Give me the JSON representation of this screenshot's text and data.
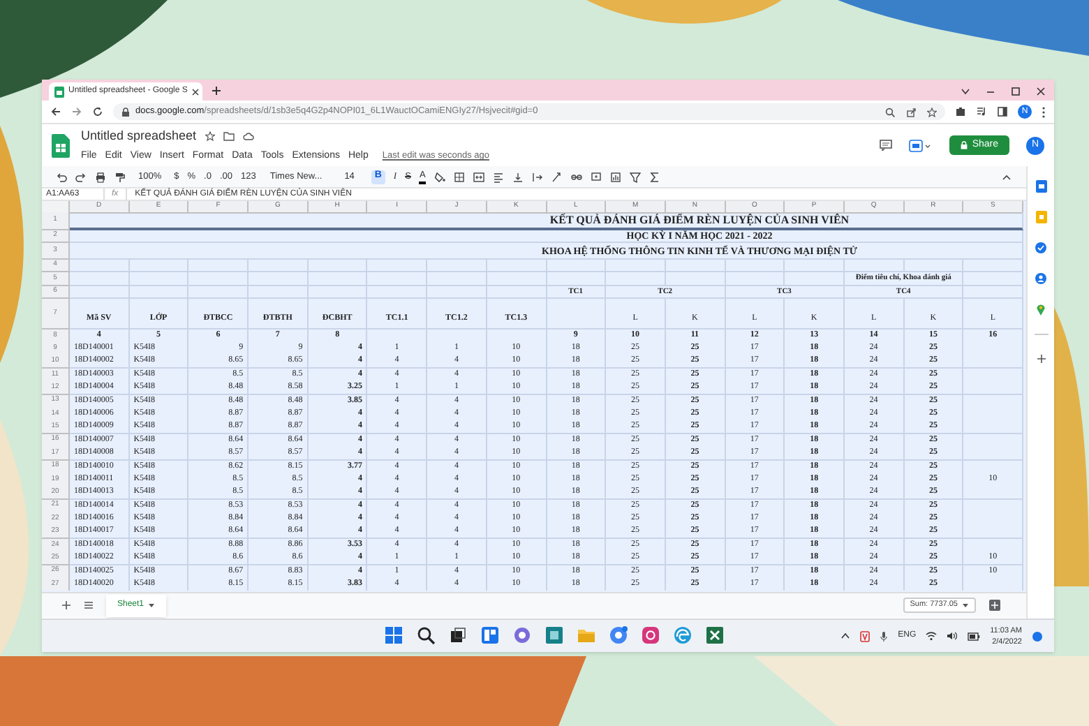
{
  "browser": {
    "tab_title": "Untitled spreadsheet - Google S",
    "url_domain": "docs.google.com",
    "url_path": "/spreadsheets/d/1sb3e5q4G2p4NOPI01_6L1WauctOCamiENGIy27/Hsjvecit#gid=0",
    "avatar": "N"
  },
  "doc": {
    "title": "Untitled spreadsheet",
    "menu": [
      "File",
      "Edit",
      "View",
      "Insert",
      "Format",
      "Data",
      "Tools",
      "Extensions",
      "Help"
    ],
    "last_edit": "Last edit was seconds ago",
    "share": "Share",
    "avatar": "N"
  },
  "toolbar": {
    "zoom": "100%",
    "currency": "$",
    "percent": "%",
    "decimal_less": ".0",
    "decimal_more": ".00",
    "number_format": "123",
    "font": "Times New...",
    "font_size": "14",
    "bold": {
      "label": "B",
      "on": true
    },
    "italic": "I",
    "strike": "S",
    "text_color": "A"
  },
  "formula_bar": {
    "cell_ref": "A1:AA63",
    "fx": "fx",
    "content": "KẾT QUẢ ĐÁNH GIÁ ĐIỂM RÈN LUYỆN CỦA SINH VIÊN"
  },
  "sheet": {
    "columns": [
      "D",
      "E",
      "F",
      "G",
      "H",
      "I",
      "J",
      "K",
      "L",
      "M",
      "N",
      "O",
      "P",
      "Q",
      "R",
      "S"
    ],
    "rows": [
      {
        "row": "1",
        "kind": "title",
        "text": "KẾT QUẢ ĐÁNH GIÁ ĐIỂM RÈN LUYỆN CỦA SINH VIÊN"
      },
      {
        "row": "2",
        "kind": "title",
        "text": "HỌC KỲ I NĂM HỌC 2021 - 2022"
      },
      {
        "row": "3",
        "kind": "title",
        "text": "KHOA HỆ THỐNG THÔNG TIN KINH TẾ VÀ THƯƠNG MẠI ĐIỆN TỬ"
      },
      {
        "row": "4",
        "kind": "blank"
      },
      {
        "row": "5",
        "kind": "note",
        "text": "Điểm tiêu chí, Khoa đánh giá"
      },
      {
        "row": "6",
        "kind": "groups",
        "groups": [
          "TC1",
          "TC2",
          "TC3",
          "TC4"
        ]
      },
      {
        "row": "7",
        "kind": "labels",
        "cells": [
          "Mã SV",
          "LỚP",
          "ĐTBCC",
          "ĐTBTH",
          "ĐCBHT",
          "TC1.1",
          "TC1.2",
          "TC1.3"
        ],
        "sub": [
          "L",
          "K",
          "L",
          "K",
          "L",
          "K",
          "L"
        ]
      },
      {
        "row": "8",
        "kind": "index",
        "cells": [
          "4",
          "5",
          "6",
          "7",
          "8"
        ],
        "sub": [
          "9",
          "10",
          "11",
          "12",
          "13",
          "14",
          "15",
          "16"
        ]
      },
      {
        "row": "9",
        "kind": "data",
        "cells": [
          "18D140001",
          "K54I8",
          "9",
          "9",
          "4",
          "1",
          "1",
          "10",
          "18",
          "25",
          "25",
          "17",
          "18",
          "24",
          "25"
        ]
      },
      {
        "row": "10",
        "kind": "data",
        "cells": [
          "18D140002",
          "K54I8",
          "8.65",
          "8.65",
          "4",
          "4",
          "4",
          "10",
          "18",
          "25",
          "25",
          "17",
          "18",
          "24",
          "25"
        ]
      },
      {
        "row": "11",
        "kind": "data",
        "cells": [
          "18D140003",
          "K54I8",
          "8.5",
          "8.5",
          "4",
          "4",
          "4",
          "10",
          "18",
          "25",
          "25",
          "17",
          "18",
          "24",
          "25"
        ]
      },
      {
        "row": "12",
        "kind": "data",
        "cells": [
          "18D140004",
          "K54I8",
          "8.48",
          "8.58",
          "3.25",
          "1",
          "1",
          "10",
          "18",
          "25",
          "25",
          "17",
          "18",
          "24",
          "25"
        ]
      },
      {
        "row": "13",
        "kind": "data",
        "cells": [
          "18D140005",
          "K54I8",
          "8.48",
          "8.48",
          "3.85",
          "4",
          "4",
          "10",
          "18",
          "25",
          "25",
          "17",
          "18",
          "24",
          "25"
        ]
      },
      {
        "row": "14",
        "kind": "data",
        "cells": [
          "18D140006",
          "K54I8",
          "8.87",
          "8.87",
          "4",
          "4",
          "4",
          "10",
          "18",
          "25",
          "25",
          "17",
          "18",
          "24",
          "25"
        ]
      },
      {
        "row": "15",
        "kind": "data",
        "cells": [
          "18D140009",
          "K54I8",
          "8.87",
          "8.87",
          "4",
          "4",
          "4",
          "10",
          "18",
          "25",
          "25",
          "17",
          "18",
          "24",
          "25"
        ]
      },
      {
        "row": "16",
        "kind": "data",
        "cells": [
          "18D140007",
          "K54I8",
          "8.64",
          "8.64",
          "4",
          "4",
          "4",
          "10",
          "18",
          "25",
          "25",
          "17",
          "18",
          "24",
          "25"
        ]
      },
      {
        "row": "17",
        "kind": "data",
        "cells": [
          "18D140008",
          "K54I8",
          "8.57",
          "8.57",
          "4",
          "4",
          "4",
          "10",
          "18",
          "25",
          "25",
          "17",
          "18",
          "24",
          "25"
        ]
      },
      {
        "row": "18",
        "kind": "data",
        "cells": [
          "18D140010",
          "K54I8",
          "8.62",
          "8.15",
          "3.77",
          "4",
          "4",
          "10",
          "18",
          "25",
          "25",
          "17",
          "18",
          "24",
          "25"
        ]
      },
      {
        "row": "19",
        "kind": "data",
        "cells": [
          "18D140011",
          "K54I8",
          "8.5",
          "8.5",
          "4",
          "4",
          "4",
          "10",
          "18",
          "25",
          "25",
          "17",
          "18",
          "24",
          "25"
        ],
        "extra": "10"
      },
      {
        "row": "20",
        "kind": "data",
        "cells": [
          "18D140013",
          "K54I8",
          "8.5",
          "8.5",
          "4",
          "4",
          "4",
          "10",
          "18",
          "25",
          "25",
          "17",
          "18",
          "24",
          "25"
        ]
      },
      {
        "row": "21",
        "kind": "data",
        "cells": [
          "18D140014",
          "K54I8",
          "8.53",
          "8.53",
          "4",
          "4",
          "4",
          "10",
          "18",
          "25",
          "25",
          "17",
          "18",
          "24",
          "25"
        ]
      },
      {
        "row": "22",
        "kind": "data",
        "cells": [
          "18D140016",
          "K54I8",
          "8.84",
          "8.84",
          "4",
          "4",
          "4",
          "10",
          "18",
          "25",
          "25",
          "17",
          "18",
          "24",
          "25"
        ]
      },
      {
        "row": "23",
        "kind": "data",
        "cells": [
          "18D140017",
          "K54I8",
          "8.64",
          "8.64",
          "4",
          "4",
          "4",
          "10",
          "18",
          "25",
          "25",
          "17",
          "18",
          "24",
          "25"
        ]
      },
      {
        "row": "24",
        "kind": "data",
        "cells": [
          "18D140018",
          "K54I8",
          "8.88",
          "8.86",
          "3.53",
          "4",
          "4",
          "10",
          "18",
          "25",
          "25",
          "17",
          "18",
          "24",
          "25"
        ]
      },
      {
        "row": "25",
        "kind": "data",
        "cells": [
          "18D140022",
          "K54I8",
          "8.6",
          "8.6",
          "4",
          "1",
          "1",
          "10",
          "18",
          "25",
          "25",
          "17",
          "18",
          "24",
          "25"
        ],
        "extra": "10"
      },
      {
        "row": "26",
        "kind": "data",
        "cells": [
          "18D140025",
          "K54I8",
          "8.67",
          "8.83",
          "4",
          "1",
          "4",
          "10",
          "18",
          "25",
          "25",
          "17",
          "18",
          "24",
          "25"
        ],
        "extra": "10"
      },
      {
        "row": "27",
        "kind": "data",
        "cells": [
          "18D140020",
          "K54I8",
          "8.15",
          "8.15",
          "3.83",
          "4",
          "4",
          "10",
          "18",
          "25",
          "25",
          "17",
          "18",
          "24",
          "25"
        ]
      }
    ]
  },
  "sheet_tabs": [
    {
      "label": "Sheet1",
      "selected": true
    }
  ],
  "sum": "Sum: 7737.05",
  "taskbar": {
    "language": "ENG",
    "time": "11:03 AM",
    "date": "2/4/2022"
  }
}
